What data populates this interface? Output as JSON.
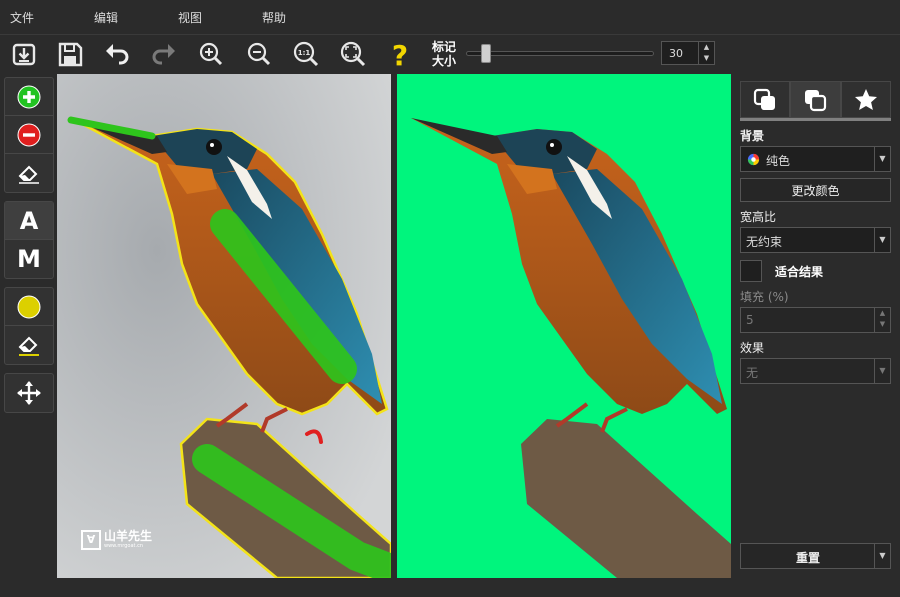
{
  "menu": {
    "file": "文件",
    "edit": "编辑",
    "view": "视图",
    "help": "帮助"
  },
  "toolbar": {
    "mark_size_label": "标记\n大小",
    "mark_size_line1": "标记",
    "mark_size_line2": "大小",
    "mark_size_value": "30",
    "mark_size_slider_fraction": 0.08,
    "icons": [
      "import-icon",
      "save-icon",
      "undo-icon",
      "redo-icon",
      "zoom-in-icon",
      "zoom-out-icon",
      "actual-size-icon",
      "fit-icon",
      "help-icon"
    ]
  },
  "tools": {
    "auto_label": "A",
    "manual_label": "M"
  },
  "canvas": {
    "watermark_text": "山羊先生",
    "watermark_url": "www.mrgoat.cn",
    "watermark_mark": "∀"
  },
  "panel": {
    "background_label": "背景",
    "background_value": "纯色",
    "change_color_label": "更改颜色",
    "aspect_label": "宽高比",
    "aspect_value": "无约束",
    "fit_result_label": "适合结果",
    "fill_label": "填充 (%)",
    "fill_value": "5",
    "effect_label": "效果",
    "effect_value": "无",
    "reset_label": "重置"
  },
  "colors": {
    "result_background": "#00f57d",
    "keep_mark": "#2ec41c",
    "remove_mark": "#e02020",
    "outline": "#f3e319",
    "accent_yellow": "#f2d600"
  }
}
